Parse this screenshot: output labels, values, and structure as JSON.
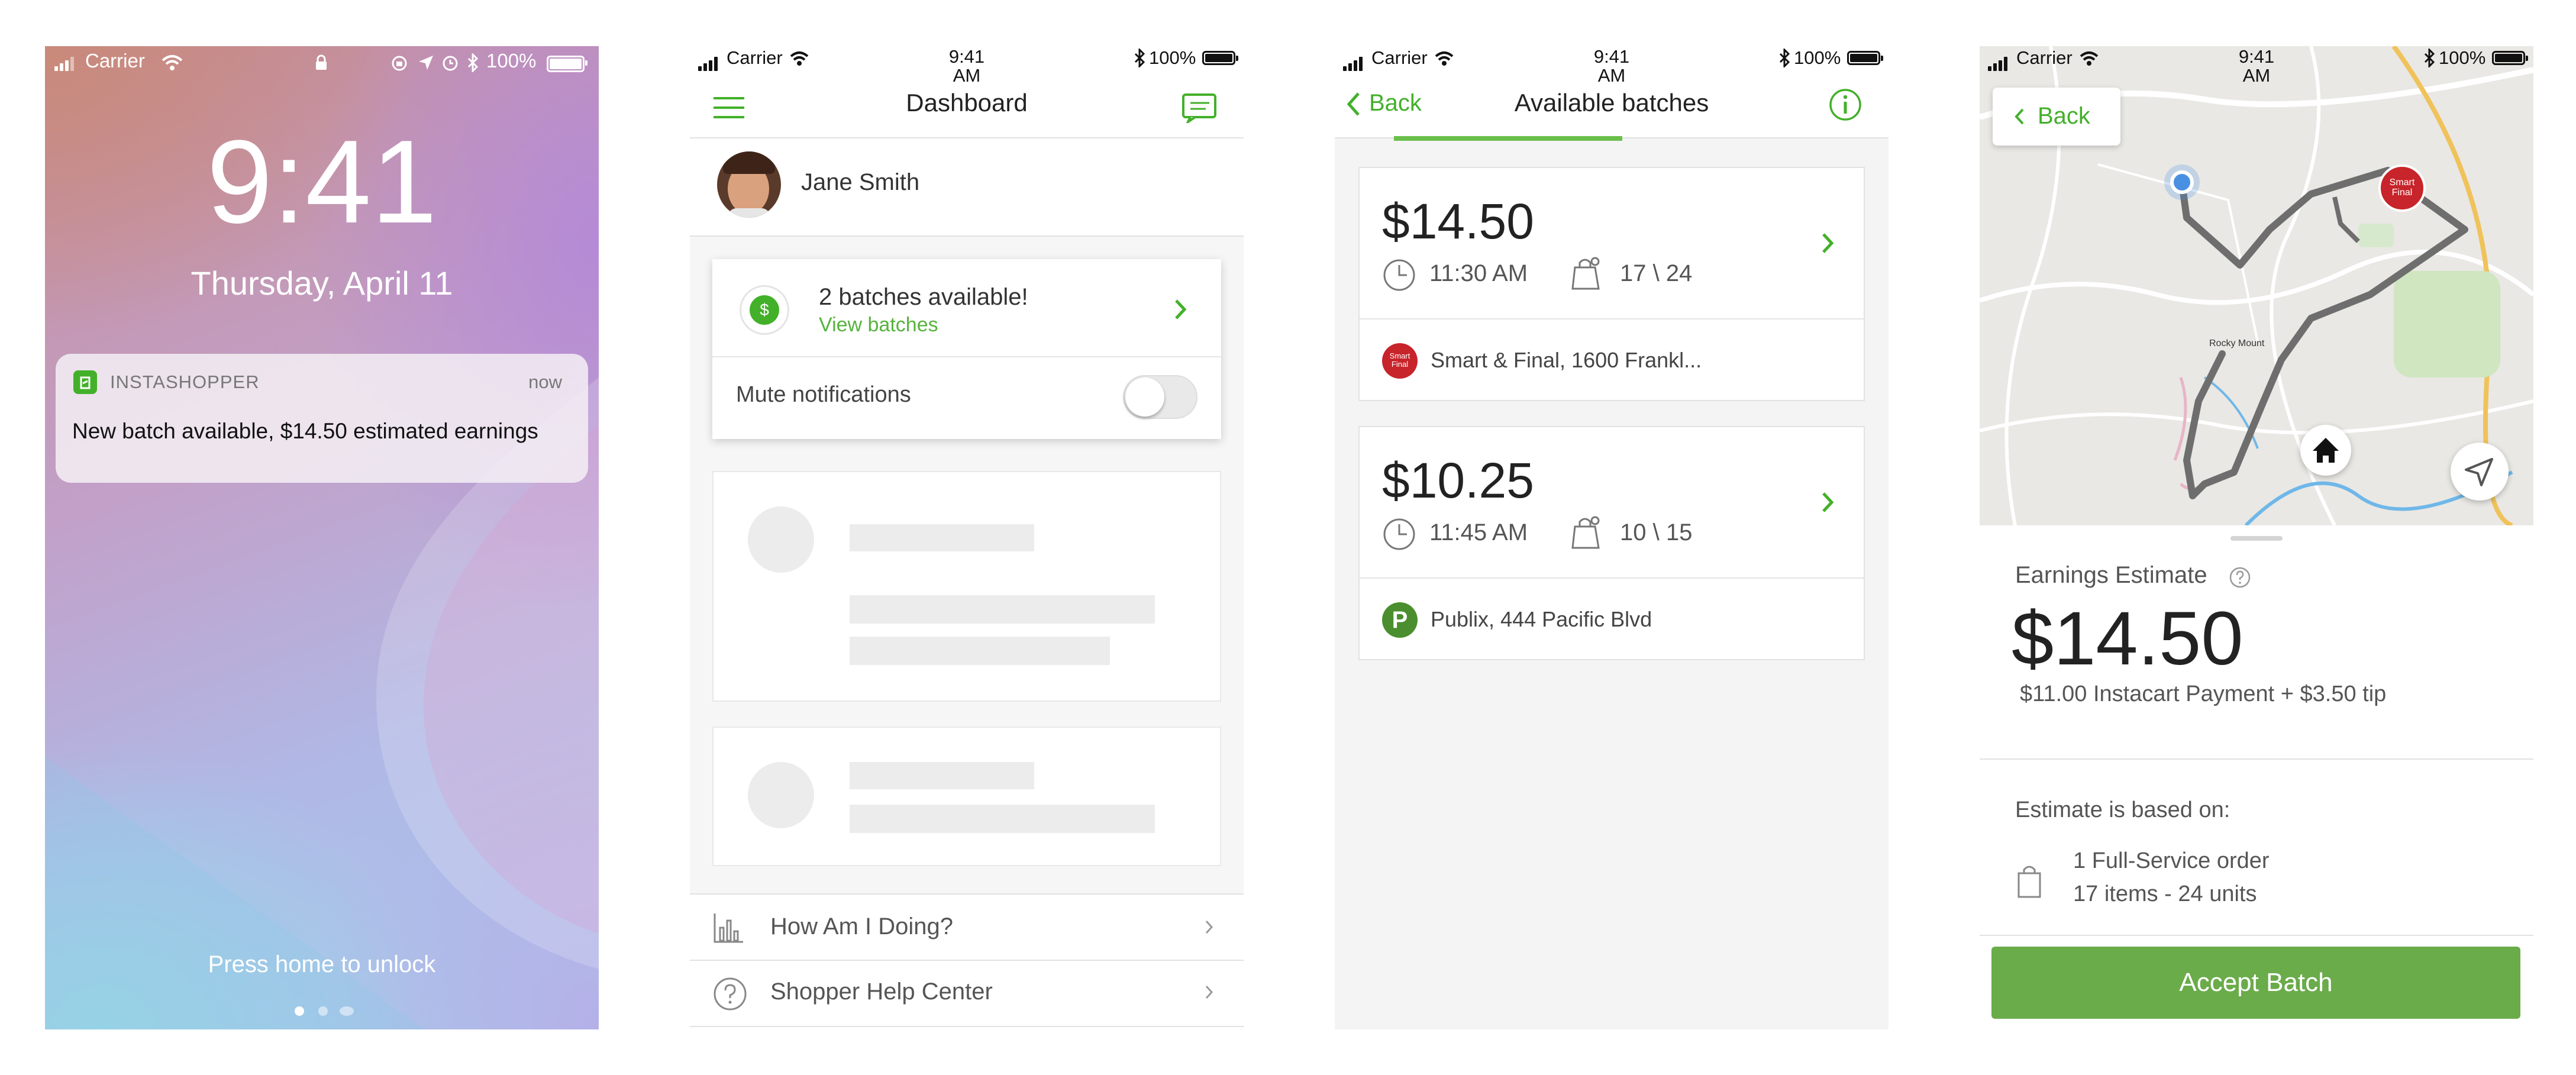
{
  "status": {
    "carrier": "Carrier",
    "time": "9:41",
    "time_line1": "9:41",
    "time_line2": "AM",
    "battery": "100%"
  },
  "lock": {
    "time": "9:41",
    "date": "Thursday, April 11",
    "notification": {
      "app": "INSTASHOPPER",
      "when": "now",
      "message": "New batch available, $14.50 estimated earnings"
    },
    "unlock_hint": "Press home to unlock"
  },
  "dashboard": {
    "title": "Dashboard",
    "user_name": "Jane Smith",
    "batches_title": "2 batches available!",
    "batches_link": "View batches",
    "mute_label": "Mute notifications",
    "menu": [
      {
        "label": "How Am I Doing?",
        "icon": "bar-chart-icon"
      },
      {
        "label": "Shopper Help Center",
        "icon": "question-circle-icon"
      }
    ]
  },
  "batches": {
    "back_label": "Back",
    "title": "Available batches",
    "items": [
      {
        "price": "$14.50",
        "time": "11:30 AM",
        "counts": "17 \\ 24",
        "store": "Smart & Final, 1600 Frankl...",
        "store_logo": "Smart Final"
      },
      {
        "price": "$10.25",
        "time": "11:45 AM",
        "counts": "10 \\ 15",
        "store": "Publix, 444 Pacific Blvd",
        "store_logo": "P"
      }
    ]
  },
  "detail": {
    "back_label": "Back",
    "map_labels": [
      "Rocky Mount"
    ],
    "store_logo": "Smart Final",
    "earnings_label": "Earnings Estimate",
    "earnings_value": "$14.50",
    "earnings_breakdown": "$11.00 Instacart Payment + $3.50 tip",
    "basis_label": "Estimate is based on:",
    "order_line1": "1 Full-Service order",
    "order_line2": "17 items - 24 units",
    "accept_label": "Accept Batch"
  },
  "colors": {
    "brand_green": "#43b02a",
    "accept_green": "#6aab4a",
    "link_green": "#56b33e",
    "text_dark": "#222222",
    "text_grey": "#666666"
  }
}
